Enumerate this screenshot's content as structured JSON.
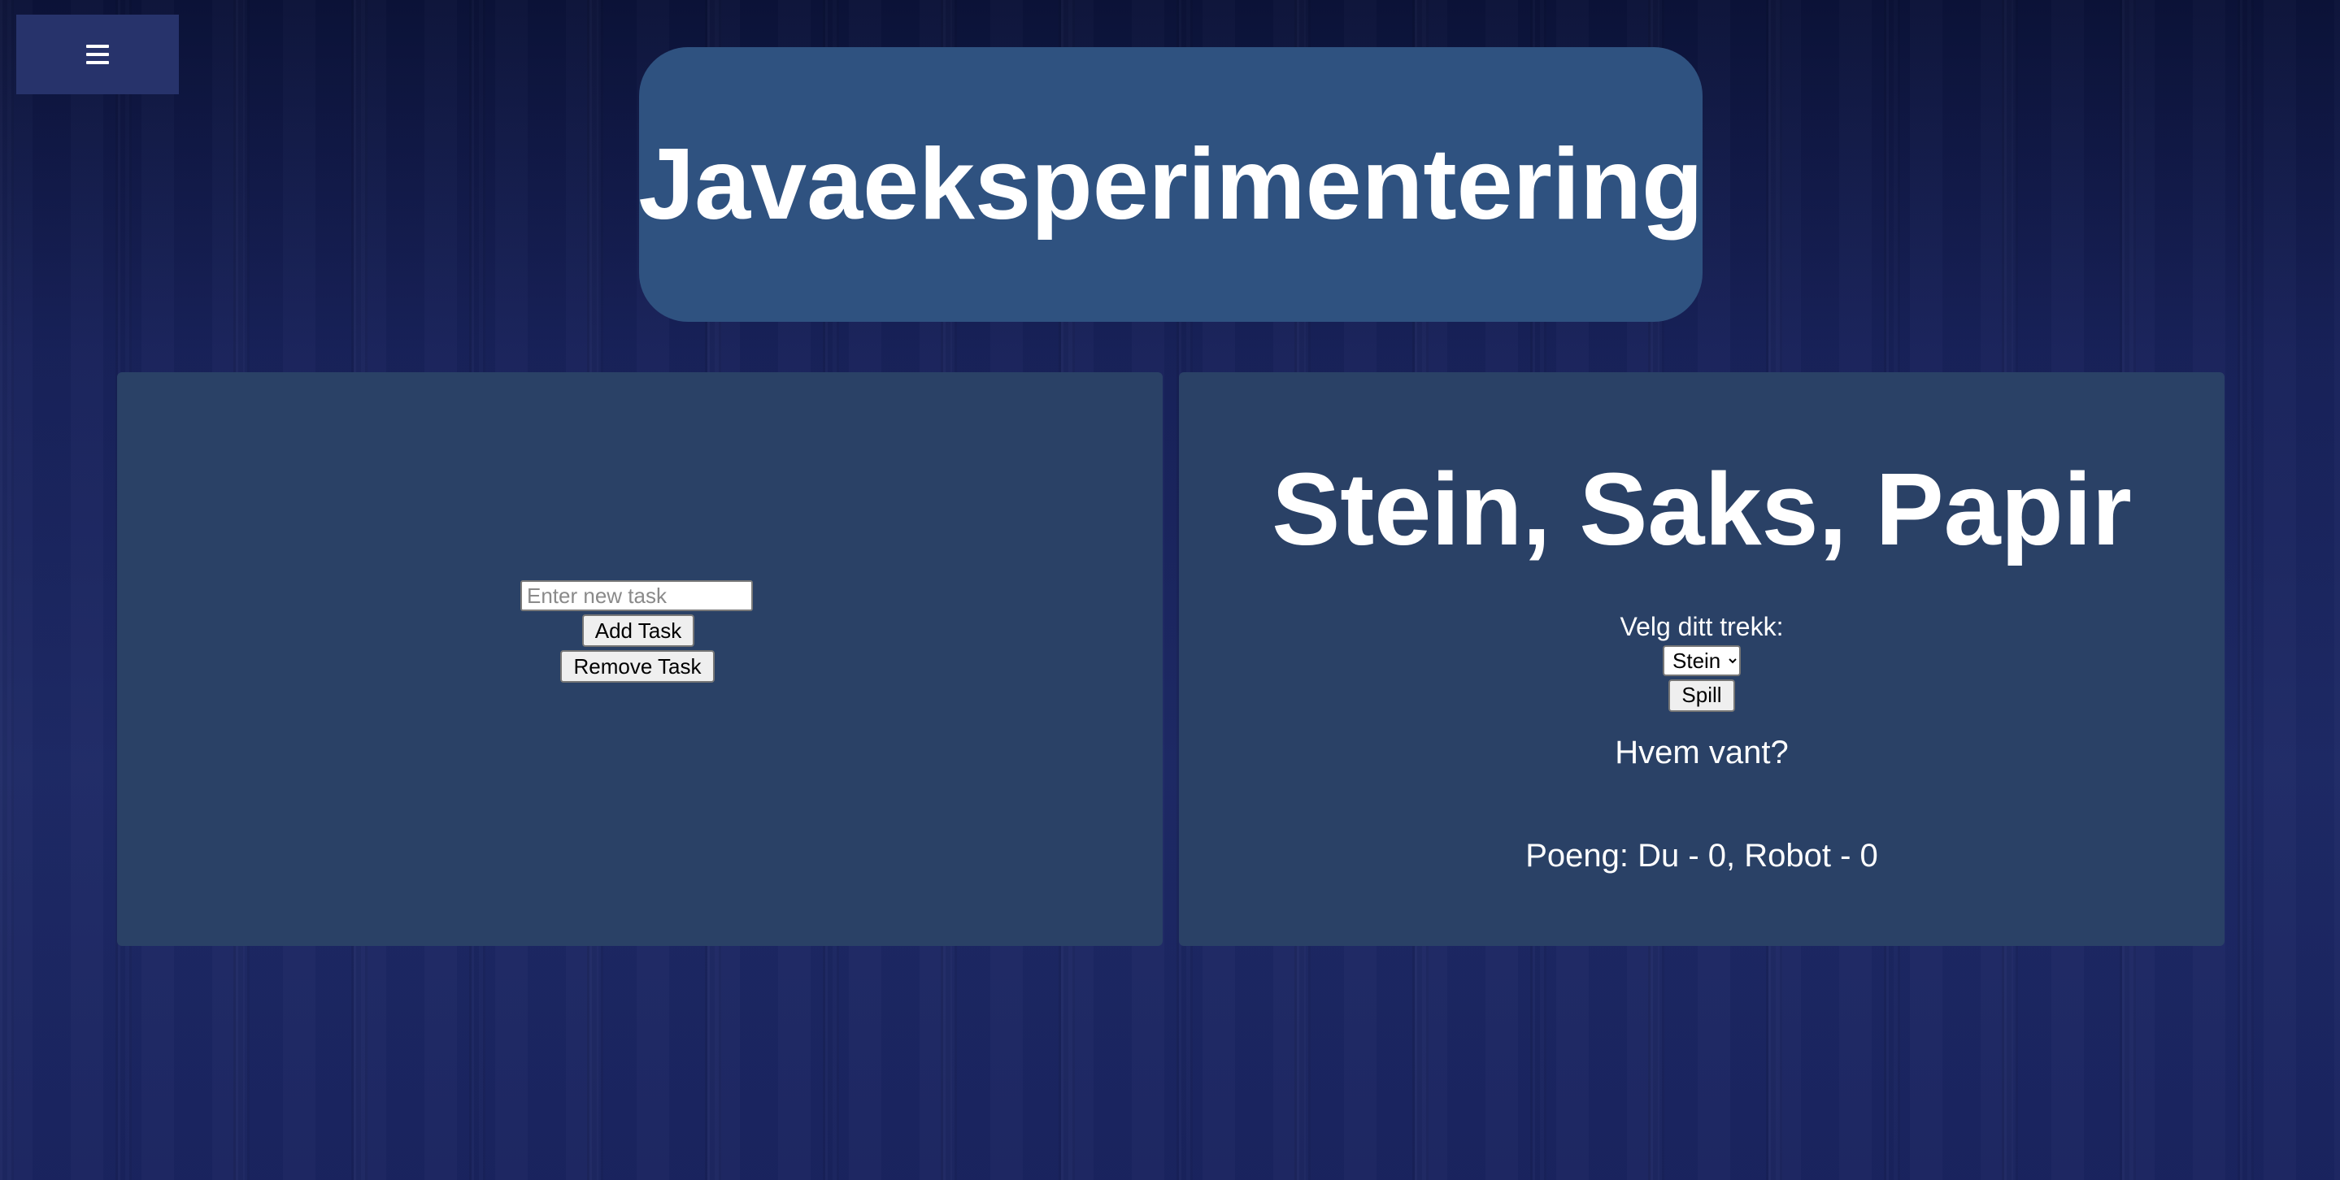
{
  "menu": {
    "icon": "hamburger-menu-icon"
  },
  "header": {
    "title": "Javaeksperimentering"
  },
  "todo": {
    "input_placeholder": "Enter new task",
    "add_label": "Add Task",
    "remove_label": "Remove Task"
  },
  "game": {
    "title": "Stein, Saks, Papir",
    "prompt": "Velg ditt trekk:",
    "selected_move": "Stein",
    "play_label": "Spill",
    "result": "Hvem vant?",
    "score": "Poeng: Du - 0, Robot - 0"
  },
  "colors": {
    "menu_bg": "#27336b",
    "title_bg": "#2f5280",
    "panel_bg": "#2a4166",
    "text": "#ffffff"
  }
}
